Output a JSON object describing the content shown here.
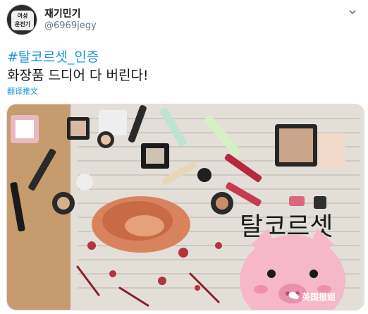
{
  "account": {
    "avatar_text": "여성\n운전기",
    "display_name": "재기민기",
    "handle": "@6969jegy"
  },
  "tweet": {
    "hashtag": "#탈코르셋_인증",
    "text": "화장품 드디어 다 버린다!",
    "translate_label": "翻译推文"
  },
  "photo": {
    "caption_overlay": "탈코르셋",
    "watermark": "英国报姐"
  },
  "icons": {
    "chevron": "chevron-down-icon",
    "watermark_logo": "wechat-logo-icon"
  },
  "colors": {
    "link": "#1b95e0",
    "text": "#14171a",
    "muted": "#657786"
  }
}
